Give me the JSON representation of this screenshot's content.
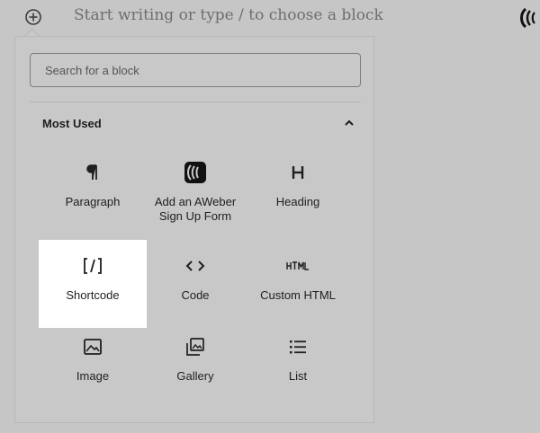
{
  "editor": {
    "placeholder": "Start writing or type / to choose a block",
    "add_icon": "plus-circle-icon"
  },
  "inserter": {
    "search_placeholder": "Search for a block",
    "section": {
      "title": "Most Used",
      "expanded": true,
      "toggle_icon": "chevron-up-icon"
    },
    "blocks": [
      {
        "label": "Paragraph",
        "icon": "paragraph-icon"
      },
      {
        "label": "Add an AWeber Sign Up Form",
        "icon": "aweber-icon"
      },
      {
        "label": "Heading",
        "icon": "heading-icon"
      },
      {
        "label": "Shortcode",
        "icon": "shortcode-icon",
        "active": true
      },
      {
        "label": "Code",
        "icon": "code-icon"
      },
      {
        "label": "Custom HTML",
        "icon": "html-icon"
      },
      {
        "label": "Image",
        "icon": "image-icon"
      },
      {
        "label": "Gallery",
        "icon": "gallery-icon"
      },
      {
        "label": "List",
        "icon": "list-icon"
      }
    ]
  },
  "colors": {
    "overlay_bg": "#c6c6c6",
    "active_tile": "#ffffff",
    "text": "#1e1e1e"
  }
}
